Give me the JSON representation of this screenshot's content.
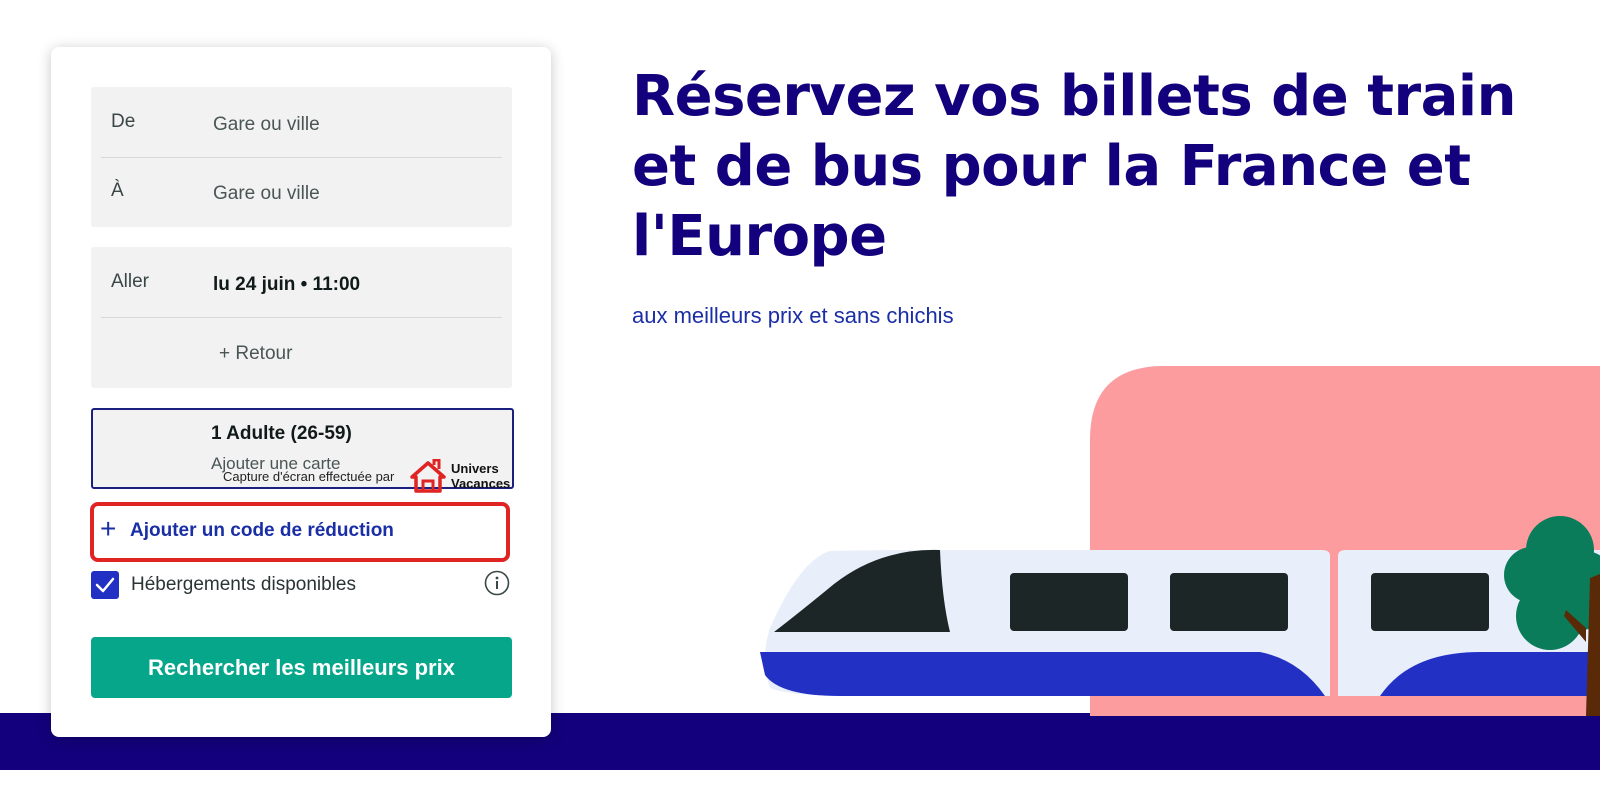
{
  "hero": {
    "title": "Réservez vos billets de train et de bus pour la France et l'Europe",
    "subtitle": "aux meilleurs prix et sans chichis"
  },
  "search_form": {
    "from": {
      "label": "De",
      "placeholder": "Gare ou ville"
    },
    "to": {
      "label": "À",
      "placeholder": "Gare ou ville"
    },
    "outbound": {
      "label": "Aller",
      "value": "lu 24 juin • 11:00"
    },
    "return_label": "+ Retour",
    "passengers": {
      "summary": "1 Adulte (26-59)",
      "add_card": "Ajouter une carte"
    },
    "promo": {
      "icon": "plus-icon",
      "label": "Ajouter un code de réduction",
      "highlight_color": "#e02323"
    },
    "accommodation": {
      "label": "Hébergements disponibles",
      "checked": true,
      "info_icon": "info-icon"
    },
    "search_button": "Rechercher les meilleurs prix"
  },
  "watermark": {
    "text": "Capture d'écran effectuée par",
    "brand": "Univers Vacances"
  },
  "colors": {
    "brand_dark": "#13007c",
    "accent_blue": "#1a2ea6",
    "cta_green": "#05a68a",
    "checkbox_blue": "#2330c4",
    "illustration_pink": "#fc9c9f"
  }
}
